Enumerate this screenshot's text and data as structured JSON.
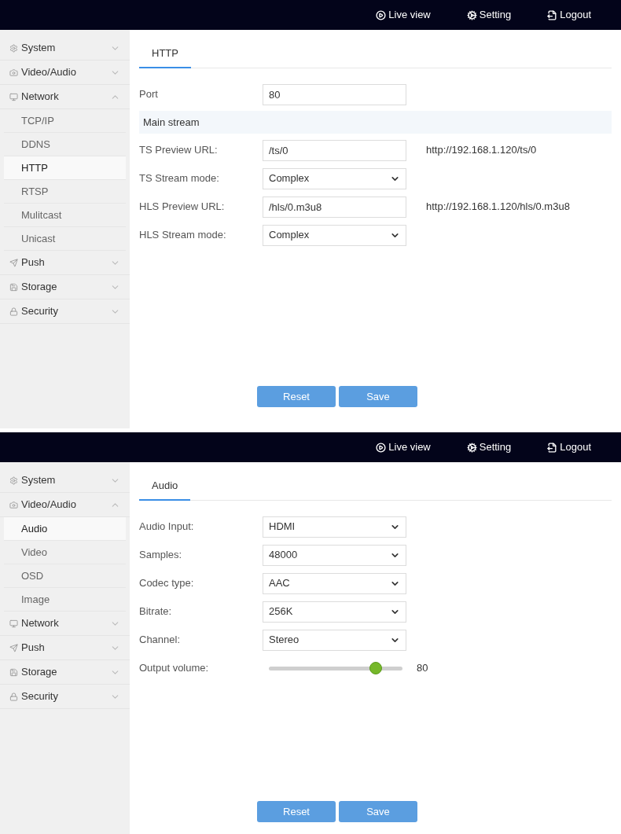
{
  "screens": [
    {
      "nav": [
        {
          "kind": "live",
          "label": "Live view"
        },
        {
          "kind": "setting",
          "label": "Setting"
        },
        {
          "kind": "logout",
          "label": "Logout"
        }
      ],
      "sidebar": [
        {
          "kind": "system",
          "label": "System",
          "expanded": false
        },
        {
          "kind": "video",
          "label": "Video/Audio",
          "expanded": false
        },
        {
          "kind": "network",
          "label": "Network",
          "expanded": true,
          "children": [
            {
              "label": "TCP/IP",
              "selected": false
            },
            {
              "label": "DDNS",
              "selected": false
            },
            {
              "label": "HTTP",
              "selected": true
            },
            {
              "label": "RTSP",
              "selected": false
            },
            {
              "label": "Mulitcast",
              "selected": false
            },
            {
              "label": "Unicast",
              "selected": false
            }
          ]
        },
        {
          "kind": "push",
          "label": "Push",
          "expanded": false
        },
        {
          "kind": "storage",
          "label": "Storage",
          "expanded": false
        },
        {
          "kind": "security",
          "label": "Security",
          "expanded": false
        }
      ],
      "tab": "HTTP",
      "fields": [
        {
          "kind": "text",
          "label": "Port",
          "value": "80"
        },
        {
          "kind": "section",
          "label": "Main stream"
        },
        {
          "kind": "text",
          "label": "TS Preview URL:",
          "value": "/ts/0",
          "note": "http://192.168.1.120/ts/0"
        },
        {
          "kind": "select",
          "label": "TS Stream mode:",
          "value": "Complex"
        },
        {
          "kind": "text",
          "label": "HLS Preview URL:",
          "value": "/hls/0.m3u8",
          "note": "http://192.168.1.120/hls/0.m3u8"
        },
        {
          "kind": "select",
          "label": "HLS Stream mode:",
          "value": "Complex"
        }
      ],
      "buttons": [
        "Reset",
        "Save"
      ]
    },
    {
      "nav": [
        {
          "kind": "live",
          "label": "Live view"
        },
        {
          "kind": "setting",
          "label": "Setting"
        },
        {
          "kind": "logout",
          "label": "Logout"
        }
      ],
      "sidebar": [
        {
          "kind": "system",
          "label": "System",
          "expanded": false
        },
        {
          "kind": "video",
          "label": "Video/Audio",
          "expanded": true,
          "children": [
            {
              "label": "Audio",
              "selected": true
            },
            {
              "label": "Video",
              "selected": false
            },
            {
              "label": "OSD",
              "selected": false
            },
            {
              "label": "Image",
              "selected": false
            }
          ]
        },
        {
          "kind": "network",
          "label": "Network",
          "expanded": false
        },
        {
          "kind": "push",
          "label": "Push",
          "expanded": false
        },
        {
          "kind": "storage",
          "label": "Storage",
          "expanded": false
        },
        {
          "kind": "security",
          "label": "Security",
          "expanded": false
        }
      ],
      "tab": "Audio",
      "fields": [
        {
          "kind": "select",
          "label": "Audio Input:",
          "value": "HDMI"
        },
        {
          "kind": "select",
          "label": "Samples:",
          "value": "48000"
        },
        {
          "kind": "select",
          "label": "Codec type:",
          "value": "AAC"
        },
        {
          "kind": "select",
          "label": "Bitrate:",
          "value": "256K"
        },
        {
          "kind": "select",
          "label": "Channel:",
          "value": "Stereo"
        },
        {
          "kind": "slider",
          "label": "Output volume:",
          "level": 0.8,
          "reading": "80"
        }
      ],
      "buttons": [
        "Reset",
        "Save"
      ]
    }
  ]
}
